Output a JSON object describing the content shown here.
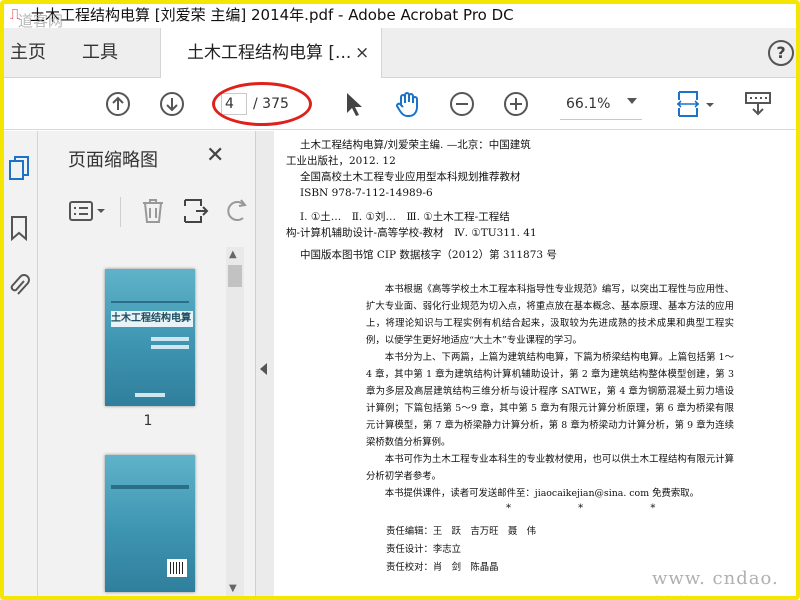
{
  "window": {
    "title": "土木工程结构电算 [刘爱荣 主编] 2014年.pdf - Adobe Acrobat Pro DC",
    "watermark_top": "道客网"
  },
  "menu": {
    "home": "主页",
    "tools": "工具"
  },
  "doc_tab": {
    "title": "土木工程结构电算 [...",
    "close": "×"
  },
  "toolbar": {
    "page_current": "4",
    "page_total": "/ 375",
    "zoom": "66.1%"
  },
  "panel": {
    "title": "页面缩略图",
    "close": "✕"
  },
  "thumbnails": [
    {
      "cover_title": "土木工程结构电算",
      "label": "1"
    },
    {
      "label": ""
    }
  ],
  "doc": {
    "cip": [
      "土木工程结构电算/刘爱荣主编. —北京：中国建筑",
      "工业出版社，2012. 12",
      "全国高校土木工程专业应用型本科规划推荐教材",
      "ISBN 978-7-112-14989-6",
      "",
      "Ⅰ. ①土…　Ⅱ. ①刘…　Ⅲ. ①土木工程-工程结",
      "构-计算机辅助设计-高等学校-教材　Ⅳ. ①TU311. 41",
      "",
      "中国版本图书馆 CIP 数据核字（2012）第 311873 号"
    ],
    "paragraphs": [
      "本书根据《高等学校土木工程本科指导性专业规范》编写，以突出工程性与应用性、扩大专业面、弱化行业规范为切入点，将重点放在基本概念、基本原理、基本方法的应用上，将理论知识与工程实例有机结合起来，汲取较为先进成熟的技术成果和典型工程实例，以便学生更好地适应“大土木”专业课程的学习。",
      "本书分为上、下两篇，上篇为建筑结构电算，下篇为桥梁结构电算。上篇包括第 1～4 章，其中第 1 章为建筑结构计算机辅助设计，第 2 章为建筑结构整体模型创建，第 3 章为多层及高层建筑结构三维分析与设计程序 SATWE，第 4 章为钢筋混凝土剪力墙设计算例；下篇包括第 5～9 章，其中第 5 章为有限元计算分析原理，第 6 章为桥梁有限元计算模型，第 7 章为桥梁静力计算分析，第 8 章为桥梁动力计算分析，第 9 章为连续梁桥数值分析算例。",
      "本书可作为土木工程专业本科生的专业教材使用，也可以供土木工程结构有限元计算分析初学者参考。",
      "本书提供课件，读者可发送邮件至：jiaocaikejian@sina. com 免费索取。"
    ],
    "stars": "* * *",
    "credits": [
      "责任编辑：王　跃　吉万旺　聂　伟",
      "责任设计：李志立",
      "责任校对：肖　剑　陈晶晶"
    ]
  },
  "watermark_bottom": "www. cndao. com",
  "colors": {
    "frame": "#f5e600",
    "annotation": "#e0201a",
    "accent_blue": "#1a73c8"
  }
}
